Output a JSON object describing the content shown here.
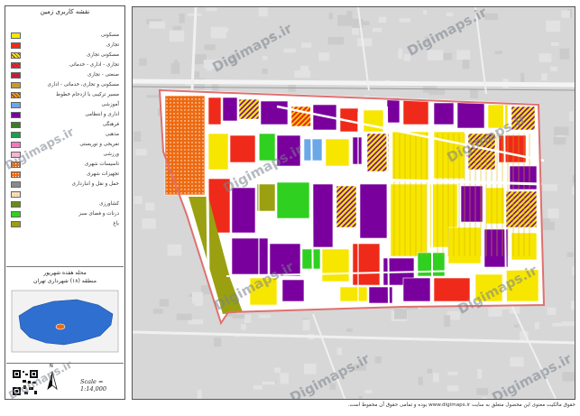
{
  "legend": {
    "title": "نقشه کاربری زمین",
    "items": [
      {
        "label": "مسکونی",
        "color": "#f7e600",
        "pattern": "solid"
      },
      {
        "label": "تجاری",
        "color": "#ef2a1a",
        "pattern": "solid"
      },
      {
        "label": "مسکونی تجاری",
        "color": "#f7e600",
        "pattern": "hatch"
      },
      {
        "label": "تجاری - اداری - خدماتی",
        "color": "#ef2a1a",
        "pattern": "hatch"
      },
      {
        "label": "صنعتی - تجاری",
        "color": "#c01e3c",
        "pattern": "solid"
      },
      {
        "label": "مسکونی و تجاری، خدماتی - اداری",
        "color": "#c79a2e",
        "pattern": "solid"
      },
      {
        "label": "مسیر ترکیبی با ازدحام خطوط",
        "color": "#e8a000",
        "pattern": "hatch"
      },
      {
        "label": "آموزشی",
        "color": "#6aa8e8",
        "pattern": "solid"
      },
      {
        "label": "اداری و انتظامی",
        "color": "#7a009e",
        "pattern": "solid"
      },
      {
        "label": "فرهنگی",
        "color": "#3a7a2a",
        "pattern": "solid"
      },
      {
        "label": "مذهبی",
        "color": "#1d9e4a",
        "pattern": "solid"
      },
      {
        "label": "تفریحی و توریستی",
        "color": "#f07ac0",
        "pattern": "solid"
      },
      {
        "label": "ورزشی",
        "color": "#f4b6d4",
        "pattern": "solid"
      },
      {
        "label": "تاسیسات شهری",
        "color": "#ee6a10",
        "pattern": "dots"
      },
      {
        "label": "تجهیزات شهری",
        "color": "#ee6a10",
        "pattern": "dots"
      },
      {
        "label": "حمل و نقل و انبارداری",
        "color": "#8a8a8a",
        "pattern": "solid"
      },
      {
        "label": "",
        "color": "#f4d8b0",
        "pattern": "dots"
      },
      {
        "label": "کشاورزی",
        "color": "#6a8a1a",
        "pattern": "solid"
      },
      {
        "label": "درنات و فضای سبز",
        "color": "#30d020",
        "pattern": "solid"
      },
      {
        "label": "باغ",
        "color": "#9aa010",
        "pattern": "solid"
      }
    ]
  },
  "location": {
    "title": "محله هفده شهریور",
    "subtitle": "منطقه (۱۸) شهرداری تهران",
    "inset_bg": "#2e6fd0"
  },
  "scale": "Scale = 1:14,000",
  "north": "N",
  "watermark": "Digimaps.ir",
  "footnote": "حقوق مالکیت معنوی این محصول متعلق به سایت www.digimaps.ir بوده و تمامی حقوق آن محفوظ است.",
  "colors": {
    "residential": "#f7e600",
    "commercial": "#ef2a1a",
    "admin": "#7a009e",
    "green": "#30d020",
    "garden": "#9aa010",
    "education": "#6aa8e8",
    "utility": "#ee6a10",
    "road": "#ffffff",
    "base": "#d7d7d7",
    "boundary": "#e07070"
  }
}
